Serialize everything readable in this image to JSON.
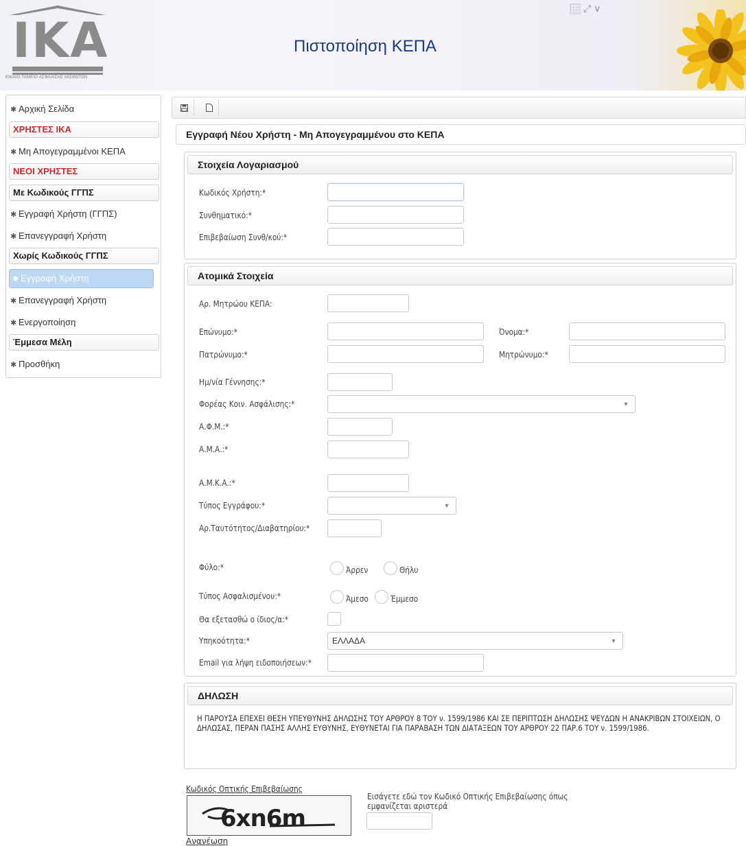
{
  "header": {
    "logo_text": "IKA",
    "logo_caption": "ΕΝΙΑΙΟ ΤΑΜΕΙΟ ΑΣΦΑΛΙΣΗΣ ΜΙΣΘΩΤΩΝ",
    "app_title": "Πιστοποίηση ΚΕΠΑ"
  },
  "sidebar": {
    "home": "Αρχική Σελίδα",
    "ika_users_head": "ΧΡΗΣΤΕΣ ΙΚΑ",
    "unregistered": "Μη Απογεγραμμένοι ΚΕΠΑ",
    "new_users_head": "ΝΕΟΙ ΧΡΗΣΤΕΣ",
    "with_codes_head": "Με Κωδικούς ΓΓΠΣ",
    "register_ggps": "Εγγραφή Χρήστη (ΓΓΠΣ)",
    "reregister_1": "Επανεγγραφή Χρήστη",
    "without_codes_head": "Χωρίς Κωδικούς ΓΓΠΣ",
    "register_user": "Εγγραφή Χρήστη",
    "reregister_2": "Επανεγγραφή Χρήστη",
    "activation": "Ενεργοποίηση",
    "indirect_head": "Έμμεσα Μέλη",
    "add": "Προσθήκη"
  },
  "main": {
    "title": "Εγγραφή Νέου Χρήστη - Μη Απογεγραμμένου στο ΚΕΠΑ"
  },
  "account": {
    "head": "Στοιχεία Λογαριασμού",
    "username_label": "Κωδικός Χρήστη:*",
    "password_label": "Συνθηματικό:*",
    "confirm_label": "Επιβεβαίωση Συνθ/κού:*"
  },
  "personal": {
    "head": "Ατομικά Στοιχεία",
    "kepa_no": "Αρ. Μητρώου ΚΕΠΑ:",
    "surname": "Επώνυμο:*",
    "name": "Όνομα:*",
    "father": "Πατρώνυμο:*",
    "mother": "Μητρώνυμο:*",
    "birth": "Ημ/νία Γέννησης:*",
    "insurer": "Φορέας Κοιν. Ασφάλισης:*",
    "afm": "Α.Φ.Μ.:*",
    "ama": "Α.Μ.Α.:*",
    "amka": "Α.Μ.Κ.Α.:*",
    "doc_type": "Τύπος Εγγράφου:*",
    "id_no": "Αρ.Ταυτότητος/Διαβατηρίου:*",
    "gender": "Φύλο:*",
    "gender_male": "Άρρεν",
    "gender_female": "Θήλυ",
    "insured_type": "Τύπος Ασφαλισμένου:*",
    "direct": "Άμεσο",
    "indirect": "Έμμεσο",
    "self_exam": "Θα εξετασθώ ο ίδιος/α:*",
    "citizenship": "Υπηκοότητα:*",
    "citizenship_value": "ΕΛΛΑΔΑ",
    "email": "Email για λήψη ειδοποιήσεων:*"
  },
  "declaration": {
    "head": "ΔΗΛΩΣΗ",
    "text": "Η ΠΑΡΟΥΣΑ ΕΠΕΧΕΙ ΘΕΣΗ ΥΠΕΥΘΥΝΗΣ ΔΗΛΩΣΗΣ ΤΟΥ ΑΡΘΡΟΥ 8 ΤΟΥ ν. 1599/1986 ΚΑΙ ΣΕ ΠΕΡΙΠΤΩΣΗ ΔΗΛΩΣΗΣ ΨΕΥΔΩΝ Η ΑΝΑΚΡΙΒΩΝ ΣΤΟΙΧΕΙΩΝ, Ο ΔΗΛΩΣΑΣ, ΠΕΡΑΝ ΠΑΣΗΣ ΑΛΛΗΣ ΕΥΘΥΝΗΣ, ΕΥΘΥΝΕΤΑΙ ΓΙΑ ΠΑΡΑΒΑΣΗ ΤΩΝ ΔΙΑΤΑΞΕΩΝ ΤΟΥ ΑΡΘΡΟΥ 22 ΠΑΡ.6 ΤΟΥ ν. 1599/1986."
  },
  "captcha": {
    "title": "Κωδικός Οπτικής Επιβεβαίωσης",
    "image_text": "6xn6m",
    "refresh": "Ανανέωση",
    "instruction": "Εισάγετε εδώ τον Κωδικό Οπτικής Επιβεβαίωσης όπως εμφανίζεται αριστερά"
  },
  "colors": {
    "title_blue": "#1a3a8a",
    "red_heading": "#d0262d",
    "active_item": "#bcd8f5"
  }
}
